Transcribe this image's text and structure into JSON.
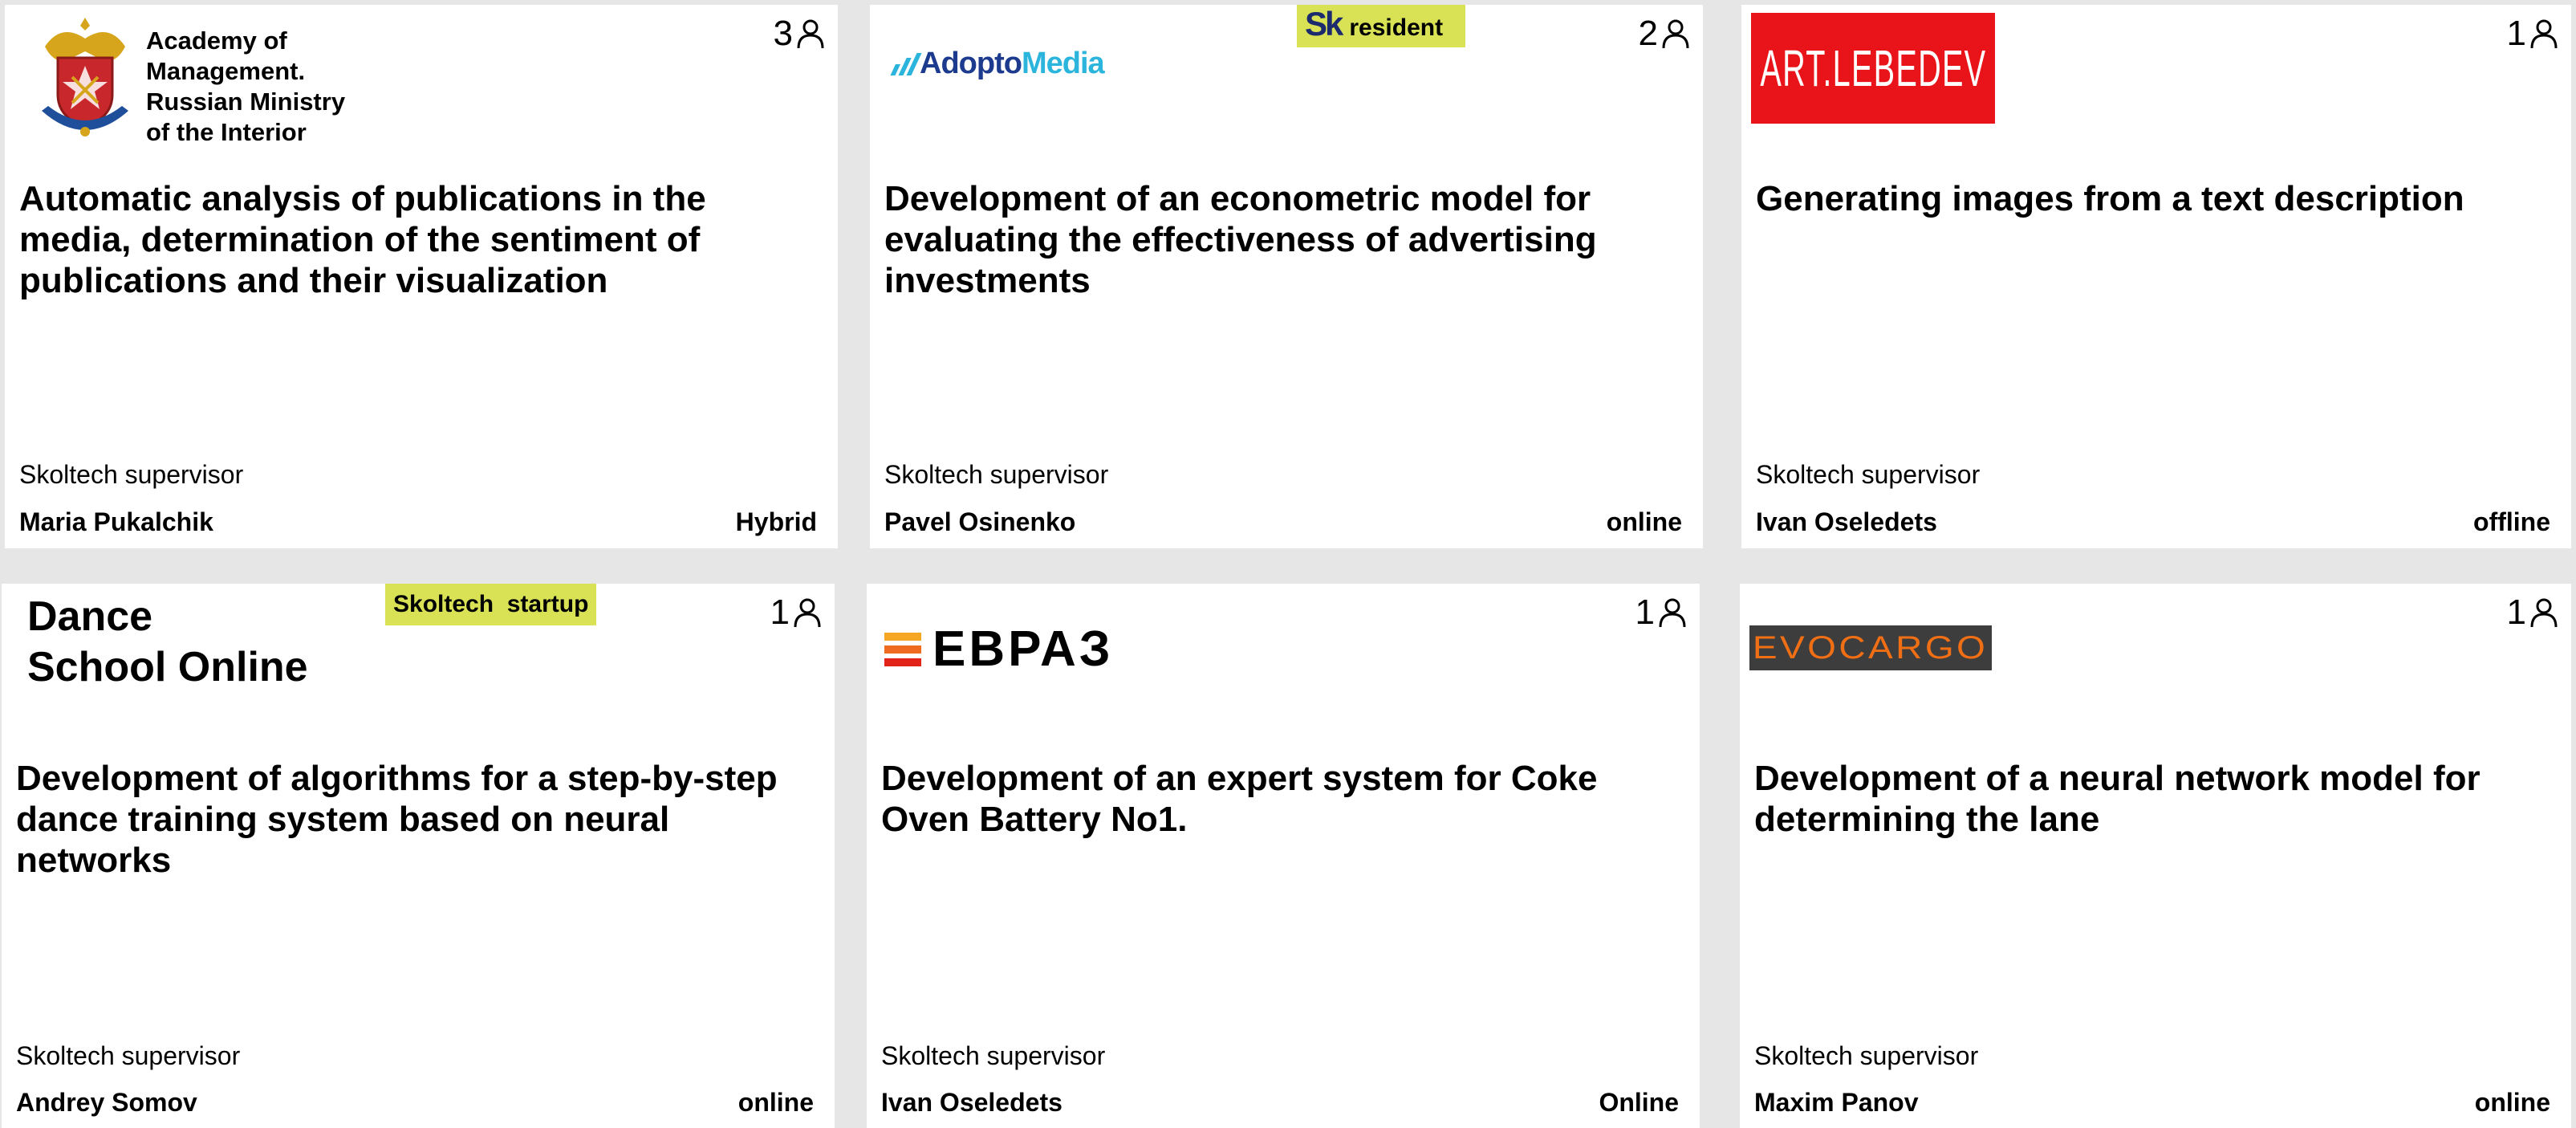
{
  "supervisor_label": "Skoltech supervisor",
  "colors": {
    "badge": "#d9e254",
    "background": "#e6e6e6",
    "lebedev_red": "#e8141a",
    "evocargo_orange": "#f06e14",
    "adopto_blue": "#2bb4dc"
  },
  "icons": {
    "participants": "person-icon"
  },
  "cards": [
    {
      "count": "3",
      "logo": {
        "lines": [
          "Academy of",
          "Management.",
          "Russian Ministry",
          "of the Interior"
        ]
      },
      "title": "Automatic analysis of publications in the media, determination of the sentiment of publications and their visualization",
      "supervisor": "Maria Pukalchik",
      "format": "Hybrid"
    },
    {
      "count": "2",
      "logo": {
        "prefix": "Adopto",
        "suffix": "Media"
      },
      "badge": {
        "mark": "Sk",
        "text": "resident"
      },
      "title": "Development of an econometric model for evaluating the effectiveness of advertising investments",
      "supervisor": "Pavel Osinenko",
      "format": "online"
    },
    {
      "count": "1",
      "logo": {
        "text": "ART.LEBEDEV"
      },
      "title": "Generating images from a text description",
      "supervisor": "Ivan Oseledets",
      "format": "offline"
    },
    {
      "count": "1",
      "logo": {
        "lines": [
          "Dance",
          "School Online"
        ]
      },
      "badge": {
        "mark": "Skoltech",
        "text": "startup"
      },
      "title": "Development of algorithms for a step-by-step dance training system based on neural networks",
      "supervisor": "Andrey Somov",
      "format": "online"
    },
    {
      "count": "1",
      "logo": {
        "text": "ЕВРАЗ"
      },
      "title": "Development of an expert system for Coke Oven Battery No1.",
      "supervisor": "Ivan Oseledets",
      "format": "Online"
    },
    {
      "count": "1",
      "logo": {
        "text": "EVOCARGO"
      },
      "title": "Development of a neural network model for determining the lane",
      "supervisor": "Maxim Panov",
      "format": "online"
    }
  ]
}
